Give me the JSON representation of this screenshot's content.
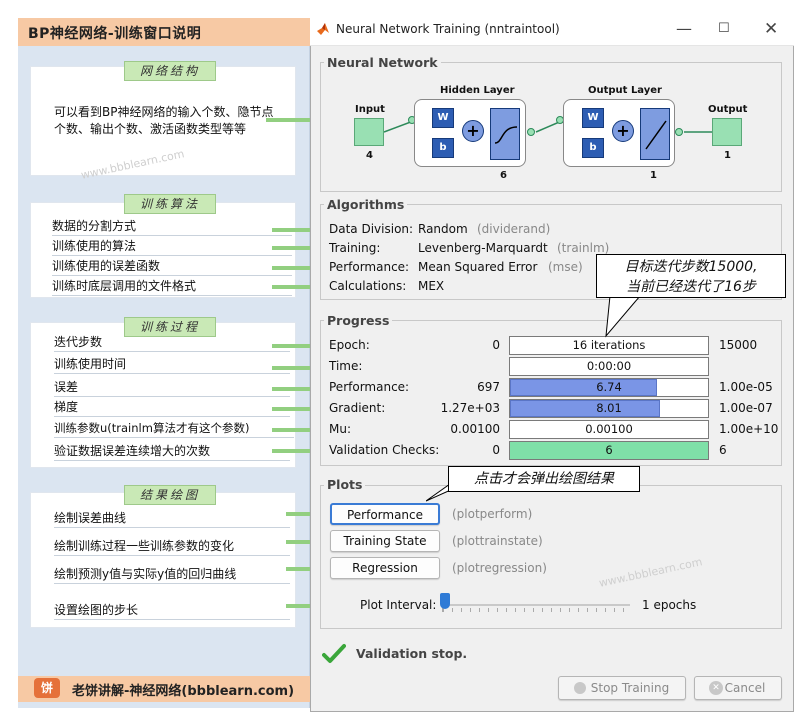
{
  "left": {
    "title": "BP神经网络-训练窗口说明",
    "sections": {
      "network": {
        "heading": "网络结构",
        "text": "可以看到BP神经网络的输入个数、隐节点个数、输出个数、激活函数类型等等"
      },
      "algorithms": {
        "heading": "训练算法",
        "items": [
          "数据的分割方式",
          "训练使用的算法",
          "训练使用的误差函数",
          "训练时底层调用的文件格式"
        ]
      },
      "process": {
        "heading": "训练过程",
        "items": [
          "迭代步数",
          "训练使用时间",
          "误差",
          "梯度",
          "训练参数u(trainlm算法才有这个参数)",
          "验证数据误差连续增大的次数"
        ]
      },
      "plots": {
        "heading": "结果绘图",
        "items": [
          "绘制误差曲线",
          "绘制训练过程一些训练参数的变化",
          "绘制预测y值与实际y值的回归曲线",
          "设置绘图的步长"
        ]
      }
    },
    "footer": {
      "logo": "饼",
      "text": "老饼讲解-神经网络(bbblearn.com)"
    }
  },
  "watermark": "www.bbblearn.com",
  "window": {
    "title": "Neural Network Training (nntraintool)",
    "network": {
      "group_title": "Neural Network",
      "input_label": "Input",
      "input_count": "4",
      "hidden_label": "Hidden Layer",
      "hidden_count": "6",
      "output_layer_label": "Output Layer",
      "output_layer_count": "1",
      "output_label": "Output",
      "output_count": "1",
      "w": "W",
      "b": "b",
      "plus": "+"
    },
    "algorithms": {
      "group_title": "Algorithms",
      "rows": [
        {
          "label": "Data Division:",
          "value": "Random",
          "fn": "(dividerand)"
        },
        {
          "label": "Training:",
          "value": "Levenberg-Marquardt",
          "fn": "(trainlm)"
        },
        {
          "label": "Performance:",
          "value": "Mean Squared Error",
          "fn": "(mse)"
        },
        {
          "label": "Calculations:",
          "value": "MEX",
          "fn": ""
        }
      ]
    },
    "progress": {
      "group_title": "Progress",
      "rows": [
        {
          "label": "Epoch:",
          "start": "0",
          "current": "16 iterations",
          "end": "15000",
          "fraction": 0.0
        },
        {
          "label": "Time:",
          "start": "",
          "current": "0:00:00",
          "end": "",
          "fraction": 0.0
        },
        {
          "label": "Performance:",
          "start": "697",
          "current": "6.74",
          "end": "1.00e-05",
          "fraction": 0.74
        },
        {
          "label": "Gradient:",
          "start": "1.27e+03",
          "current": "8.01",
          "end": "1.00e-07",
          "fraction": 0.76
        },
        {
          "label": "Mu:",
          "start": "0.00100",
          "current": "0.00100",
          "end": "1.00e+10",
          "fraction": 0.0
        },
        {
          "label": "Validation Checks:",
          "start": "0",
          "current": "6",
          "end": "6",
          "fraction": 1.0
        }
      ]
    },
    "plots": {
      "group_title": "Plots",
      "buttons": [
        {
          "label": "Performance",
          "fn": "(plotperform)"
        },
        {
          "label": "Training State",
          "fn": "(plottrainstate)"
        },
        {
          "label": "Regression",
          "fn": "(plotregression)"
        }
      ],
      "interval_label": "Plot Interval:",
      "interval_value": "1 epochs"
    },
    "status": "Validation stop.",
    "stop_button": "Stop Training",
    "cancel_button": "Cancel"
  },
  "callouts": {
    "epoch": "目标迭代步数15000,\n当前已经迭代了16步",
    "plots": "点击才会弹出绘图结果"
  }
}
